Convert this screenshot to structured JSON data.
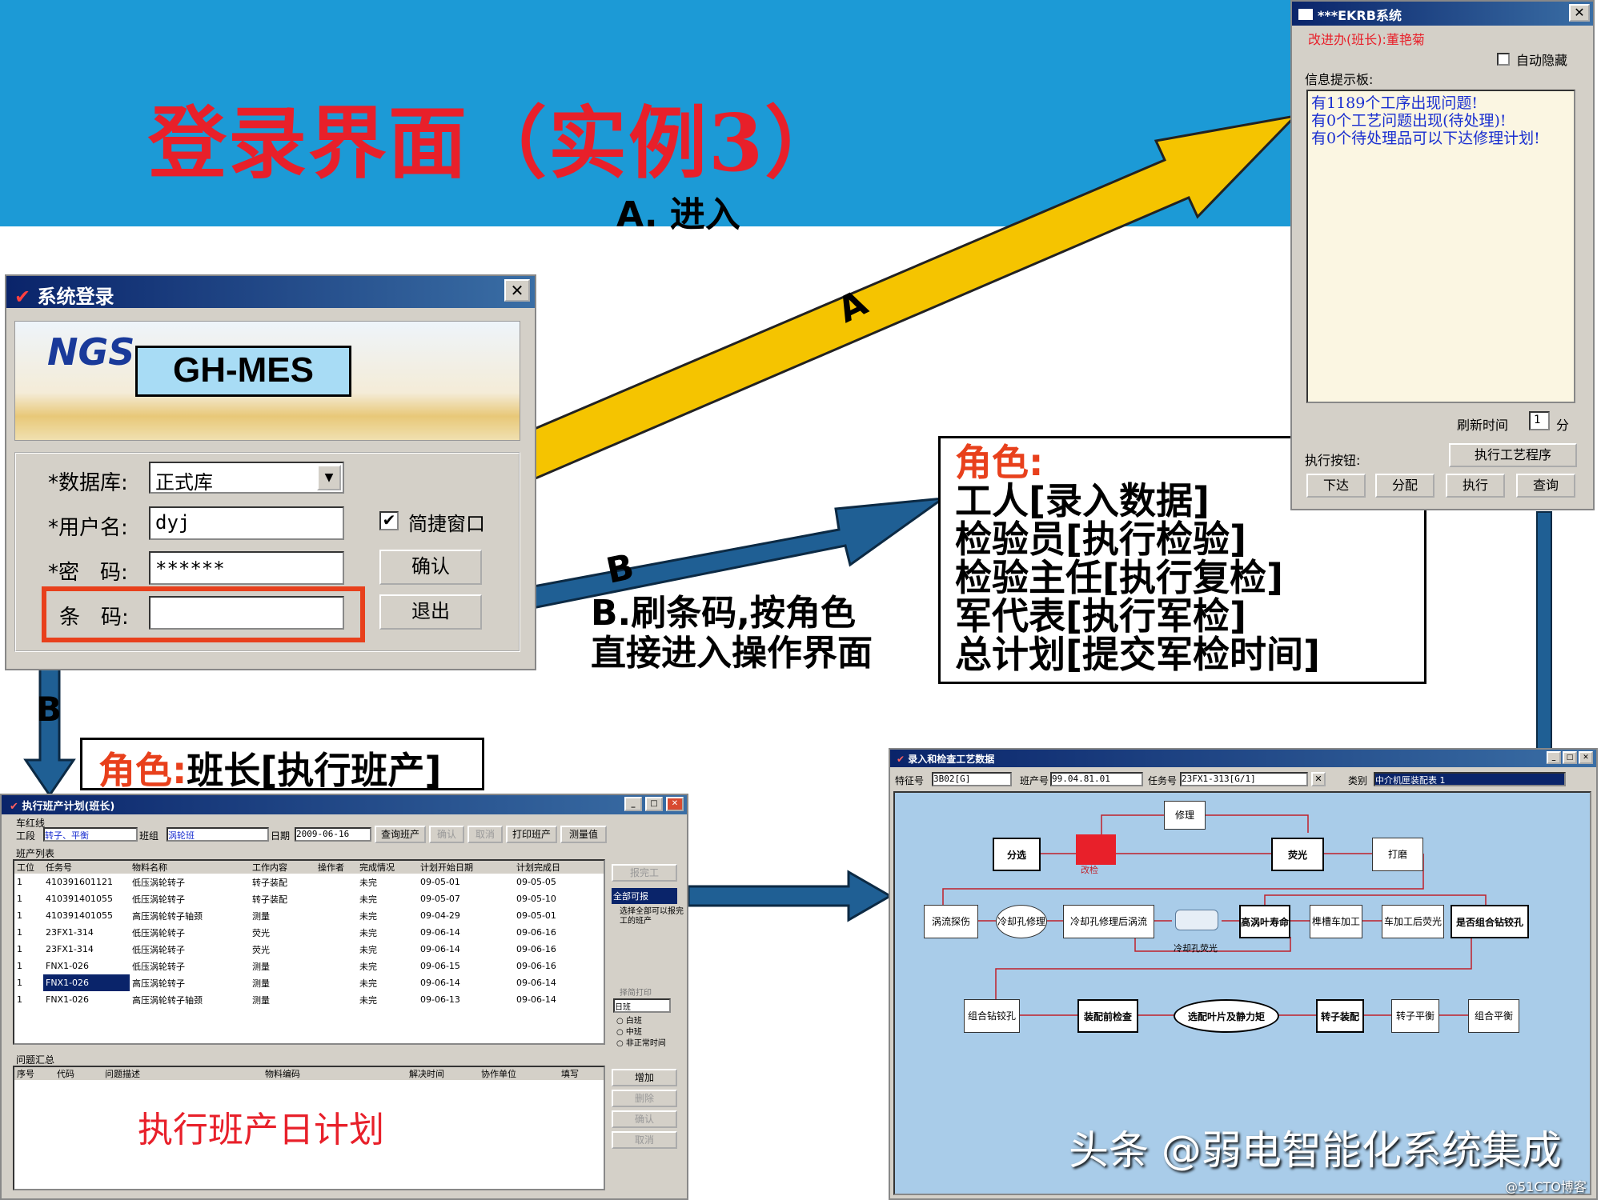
{
  "slide": {
    "title": "登录界面（实例3）",
    "label_a": "A. 进入",
    "arrow_a_letter": "A",
    "arrow_b_letter": "B",
    "arrow_b2_letter": "B",
    "label_b": "B.刷条码,按角色直接进入操作界面",
    "roles_title": "角色:",
    "roles": [
      "工人[录入数据]",
      "检验员[执行检验]",
      "检验主任[执行复检]",
      "军代表[执行军检]",
      "总计划[提交军检时间]"
    ],
    "leader_role_title": "角色:",
    "leader_role": "班长[执行班产]",
    "watermark": "头条 @弱电智能化系统集成",
    "corner_mark": "@51CTO博客",
    "colors": {
      "banner": "#1c9ad6",
      "title": "#e8202a",
      "arrow_a": "#f5c400",
      "arrow_b": "#1f5f94",
      "highlight": "#e8401c"
    }
  },
  "login": {
    "title": "系统登录",
    "logo": "NGS",
    "app_name": "GH-MES",
    "database_label": "*数据库:",
    "database_value": "正式库",
    "username_label": "*用户名:",
    "username_value": "dyj",
    "password_label": "*密　码:",
    "password_value": "******",
    "barcode_label": "条　码:",
    "barcode_value": "",
    "quick_window_label": "简捷窗口",
    "confirm_button": "确认",
    "second_button": "退出"
  },
  "ekrb": {
    "title": "***EKRB系统",
    "user_line": "改进办(班长):董艳菊",
    "auto_hide": "自动隐藏",
    "info_label": "信息提示板:",
    "messages": [
      "有1189个工序出现问题!",
      "有0个工艺问题出现(待处理)!",
      "有0个待处理品可以下达修理计划!"
    ],
    "refresh_label": "刷新时间",
    "refresh_value": "1",
    "refresh_unit": "分",
    "exec_label": "执行按钮:",
    "exec_process_button": "执行工艺程序",
    "buttons": [
      "下达",
      "分配",
      "执行",
      "查询"
    ]
  },
  "shift_plan": {
    "title": "执行班产计划(班长)",
    "group_label": "车红线",
    "section_label": "工段",
    "section_value": "转子、平衡",
    "team_label": "班组",
    "team_value": "涡轮班",
    "date_label": "日期",
    "date_value": "2009-06-16",
    "buttons": [
      "查询班产",
      "确认",
      "取消",
      "打印班产",
      "测量值"
    ],
    "list_label": "班产列表",
    "columns": [
      "工位",
      "任务号",
      "物料名称",
      "工作内容",
      "操作者",
      "完成情况",
      "计划开始日期",
      "计划完成日"
    ],
    "rows": [
      [
        "1",
        "410391601121",
        "低压涡轮转子",
        "转子装配",
        "",
        "未完",
        "09-05-01",
        "09-05-05"
      ],
      [
        "1",
        "410391401055",
        "低压涡轮转子",
        "转子装配",
        "",
        "未完",
        "09-05-07",
        "09-05-10"
      ],
      [
        "1",
        "410391401055",
        "高压涡轮转子轴颈",
        "测量",
        "",
        "未完",
        "09-04-29",
        "09-05-01"
      ],
      [
        "1",
        "23FX1-314",
        "低压涡轮转子",
        "荧光",
        "",
        "未完",
        "09-06-14",
        "09-06-16"
      ],
      [
        "1",
        "23FX1-314",
        "低压涡轮转子",
        "荧光",
        "",
        "未完",
        "09-06-14",
        "09-06-16"
      ],
      [
        "1",
        "FNX1-026",
        "低压涡轮转子",
        "测量",
        "",
        "未完",
        "09-06-15",
        "09-06-16"
      ],
      [
        "1",
        "FNX1-026",
        "高压涡轮转子",
        "测量",
        "",
        "未完",
        "09-06-14",
        "09-06-14"
      ],
      [
        "1",
        "FNX1-026",
        "高压涡轮转子轴颈",
        "测量",
        "",
        "未完",
        "09-06-13",
        "09-06-14"
      ]
    ],
    "side_button": "报完工",
    "check_all": "全部可报",
    "check_select": "选择全部可以报完工的班产",
    "print_check": "择简打印",
    "period_select": "日班",
    "radios": [
      "白班",
      "中班",
      "非正常时间"
    ],
    "issues_label": "问题汇总",
    "issue_columns": [
      "序号",
      "代码",
      "问题描述",
      "物料编码",
      "解决时间",
      "协作单位",
      "填写"
    ],
    "issue_buttons": [
      "增加",
      "删除",
      "确认",
      "取消"
    ],
    "overlay": "执行班产日计划"
  },
  "process": {
    "title": "录入和检查工艺数据",
    "feature_label": "特征号",
    "feature_value": "3B02[G]",
    "batch_label": "班产号",
    "batch_value": "99.04.81.01",
    "task_label": "任务号",
    "task_value": "23FX1-313[G/1]",
    "category_label": "类别",
    "category_value": "中介机匣装配表 1",
    "nodes": {
      "n1": "分选",
      "n2": "改检",
      "n3": "修理",
      "n4": "荧光",
      "n5": "打磨",
      "n6": "涡流探伤",
      "n7": "冷却孔修理",
      "n8": "冷却孔修理后涡流",
      "n9": "冷却孔荧光",
      "n10": "高涡叶寿命",
      "n11": "榫槽车加工",
      "n12": "车加工后荧光",
      "n13": "是否组合钻铰孔",
      "n14": "组合钻铰孔",
      "n15": "装配前检查",
      "n16": "选配叶片及静力矩",
      "n17": "转子装配",
      "n18": "转子平衡",
      "n19": "组合平衡"
    }
  }
}
